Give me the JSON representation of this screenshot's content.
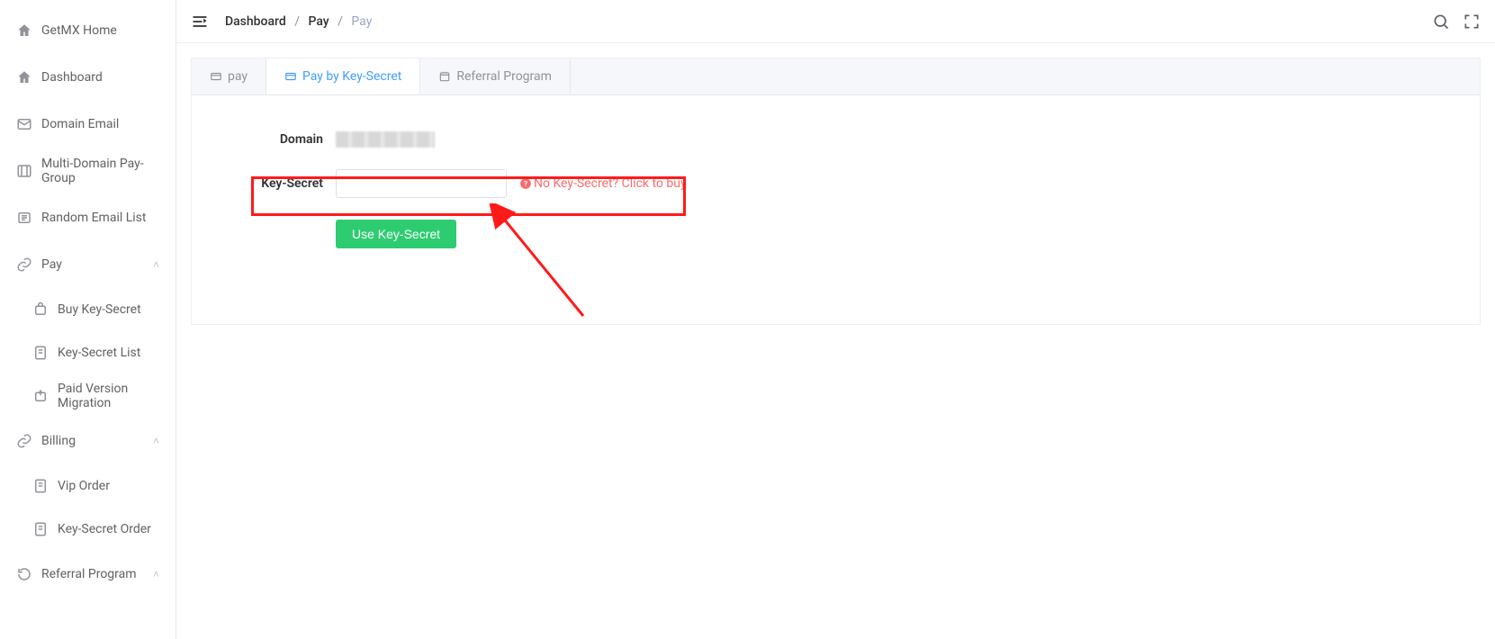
{
  "sidebar": {
    "items": [
      {
        "label": "GetMX Home"
      },
      {
        "label": "Dashboard"
      },
      {
        "label": "Domain Email"
      },
      {
        "label": "Multi-Domain Pay-Group"
      },
      {
        "label": "Random Email List"
      },
      {
        "label": "Pay",
        "expandable": true
      },
      {
        "label": "Buy Key-Secret",
        "sub": true
      },
      {
        "label": "Key-Secret List",
        "sub": true
      },
      {
        "label": "Paid Version Migration",
        "sub": true
      },
      {
        "label": "Billing",
        "expandable": true
      },
      {
        "label": "Vip Order",
        "sub": true
      },
      {
        "label": "Key-Secret Order",
        "sub": true
      },
      {
        "label": "Referral Program",
        "expandable": true
      }
    ]
  },
  "breadcrumb": {
    "a": "Dashboard",
    "b": "Pay",
    "c": "Pay"
  },
  "tabs": [
    {
      "label": "pay"
    },
    {
      "label": "Pay by Key-Secret"
    },
    {
      "label": "Referral Program"
    }
  ],
  "form": {
    "domain_label": "Domain",
    "keysecret_label": "Key-Secret",
    "help_text": "No Key-Secret? Click to buy",
    "submit_label": "Use Key-Secret"
  }
}
